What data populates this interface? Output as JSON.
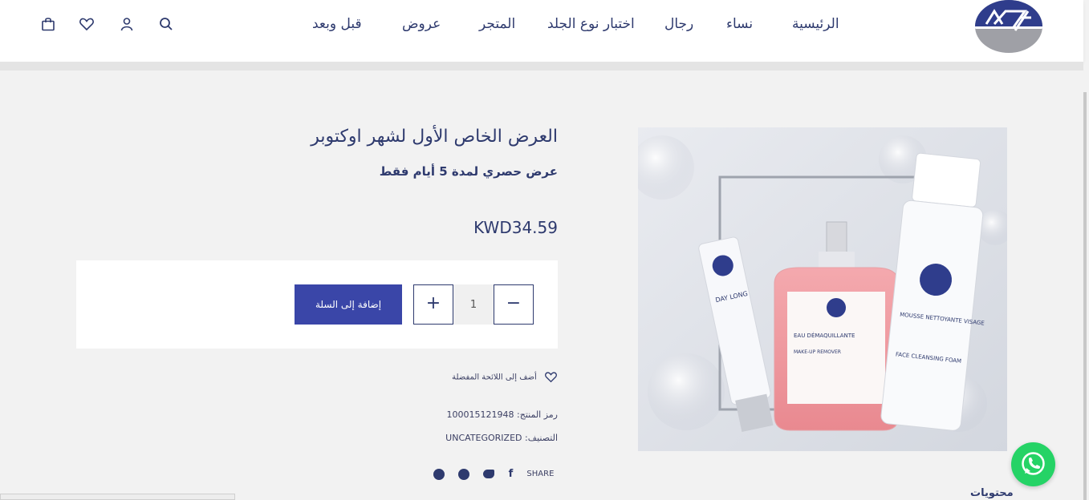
{
  "header": {
    "nav": [
      {
        "label": "الرئيسية"
      },
      {
        "label": "نساء"
      },
      {
        "label": "رجال"
      },
      {
        "label": "اختبار نوع الجلد"
      },
      {
        "label": "المتجر"
      },
      {
        "label": "عروض"
      },
      {
        "label": "قبل وبعد"
      }
    ],
    "icons": [
      "search-icon",
      "user-icon",
      "heart-icon",
      "bag-icon"
    ]
  },
  "product": {
    "title": "العرض الخاص الأول لشهر اوكتوبر",
    "subtitle": "عرض حصري لمدة 5 أيام فقط",
    "price": "KWD34.59",
    "quantity": "1",
    "add_to_cart_label": "إضافة إلى السلة",
    "wishlist_label": "أضف إلى اللائحة المفضلة",
    "sku_label": "رمز المنتج:",
    "sku_value": "100015121948",
    "category_label": "التصنيف:",
    "category_value": "UNCATEGORIZED",
    "share_label": "SHARE",
    "share_icons": [
      "facebook-icon",
      "twitter-icon",
      "pinterest-icon",
      "whatsapp-icon"
    ],
    "image_labels": {
      "tube_1": "DAY LONG",
      "bottle": "EAU DÉMAQUILLANTE",
      "bottle_sub": "MAKE-UP REMOVER",
      "foam_1": "MOUSSE NETTOYANTE VISAGE",
      "foam_2": "FACE CLEANSING FOAM"
    }
  },
  "footer": {
    "contents_label": "محتويات"
  },
  "colors": {
    "brand": "#2e3a6e",
    "button": "#3a46a8",
    "whatsapp": "#25d366"
  }
}
